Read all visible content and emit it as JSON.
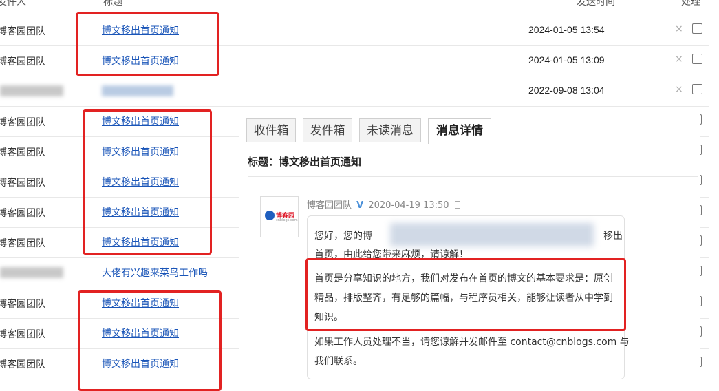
{
  "header": {
    "sender_col": "发件人",
    "title_col": "标题",
    "time_col": "发送时间",
    "action_col": "处理"
  },
  "rows": [
    {
      "sender": "博客园团队",
      "title": "博文移出首页通知",
      "time": "2024-01-05 13:54"
    },
    {
      "sender": "博客园团队",
      "title": "博文移出首页通知",
      "time": "2024-01-05 13:09"
    },
    {
      "sender": "",
      "title": "",
      "time": "2022-09-08 13:04"
    },
    {
      "sender": "博客园团队",
      "title": "博文移出首页通知",
      "time": ""
    },
    {
      "sender": "博客园团队",
      "title": "博文移出首页通知",
      "time": ""
    },
    {
      "sender": "博客园团队",
      "title": "博文移出首页通知",
      "time": ""
    },
    {
      "sender": "博客园团队",
      "title": "博文移出首页通知",
      "time": ""
    },
    {
      "sender": "博客园团队",
      "title": "博文移出首页通知",
      "time": ""
    },
    {
      "sender": "",
      "title": "大佬有兴趣来菜鸟工作吗",
      "time": ""
    },
    {
      "sender": "博客园团队",
      "title": "博文移出首页通知",
      "time": ""
    },
    {
      "sender": "博客园团队",
      "title": "博文移出首页通知",
      "time": ""
    },
    {
      "sender": "博客园团队",
      "title": "博文移出首页通知",
      "time": ""
    }
  ],
  "delete_glyph": "×",
  "panel": {
    "tabs": [
      "收件箱",
      "发件箱",
      "未读消息",
      "消息详情"
    ],
    "active_tab": 3,
    "message_title": "标题：博文移出首页通知",
    "avatar_logo": "博客园",
    "avatar_sub": "cnblogs.com",
    "sender_name": "博客园团队",
    "verified_mark": "V",
    "sent_time": "2020-04-19 13:50",
    "line1_start": "您好，您的博",
    "line1_end": "移出",
    "line2": "首页，由此给您带来麻烦，请谅解！",
    "para2": [
      "首页是分享知识的地方，我们对发布在首页的博文的基本要求是：原创",
      "精品，排版整齐，有足够的篇幅，与程序员相关，能够让读者从中学到",
      "知识。"
    ],
    "para3": [
      "如果工作人员处理不当，请您谅解并发邮件至 contact@cnblogs.com 与",
      "我们联系。"
    ]
  },
  "colors": {
    "link": "#1a55b8",
    "highlight_box": "#e22222",
    "verified": "#4a90d9"
  }
}
